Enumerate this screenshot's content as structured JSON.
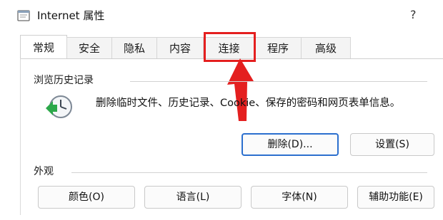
{
  "window": {
    "title": "Internet 属性",
    "help_label": "?"
  },
  "tabs": [
    {
      "label": "常规",
      "active": true
    },
    {
      "label": "安全",
      "active": false
    },
    {
      "label": "隐私",
      "active": false
    },
    {
      "label": "内容",
      "active": false
    },
    {
      "label": "连接",
      "active": false,
      "highlighted": true
    },
    {
      "label": "程序",
      "active": false
    },
    {
      "label": "高级",
      "active": false
    }
  ],
  "annotation": {
    "color": "#e41f1f",
    "target": "连接"
  },
  "browsing_history": {
    "heading": "浏览历史记录",
    "description": "删除临时文件、历史记录、Cookie、保存的密码和网页表单信息。",
    "delete_label": "删除(D)...",
    "settings_label": "设置(S)"
  },
  "appearance": {
    "heading": "外观",
    "buttons": [
      "颜色(O)",
      "语言(L)",
      "字体(N)",
      "辅助功能(E)"
    ]
  },
  "colors": {
    "accent": "#2b6fce"
  }
}
